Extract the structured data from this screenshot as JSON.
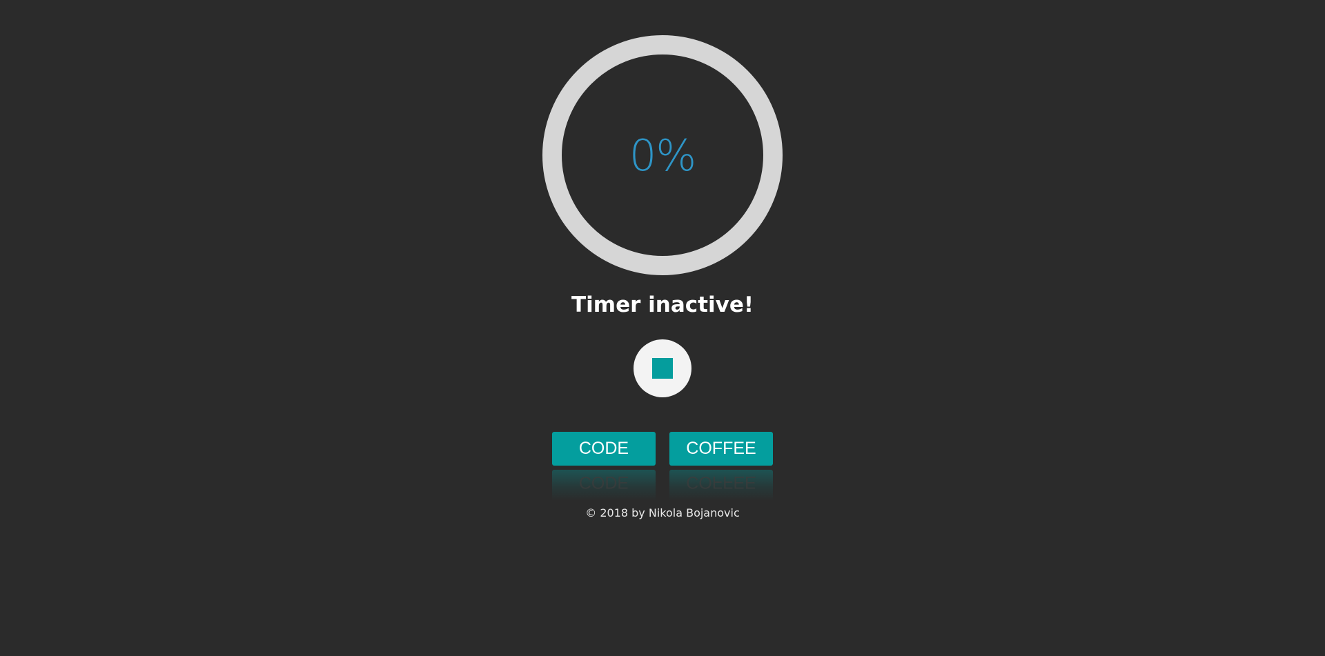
{
  "progress": {
    "percent_label": "0%",
    "value": 0,
    "ring_color": "#d6d6d6",
    "text_color": "#2e95c7"
  },
  "status": {
    "text": "Timer inactive!"
  },
  "controls": {
    "stop_icon": "stop-icon",
    "code_label": "CODE",
    "coffee_label": "COFFEE",
    "accent": "#049e9e"
  },
  "footer": {
    "text": "© 2018 by Nikola Bojanovic"
  }
}
